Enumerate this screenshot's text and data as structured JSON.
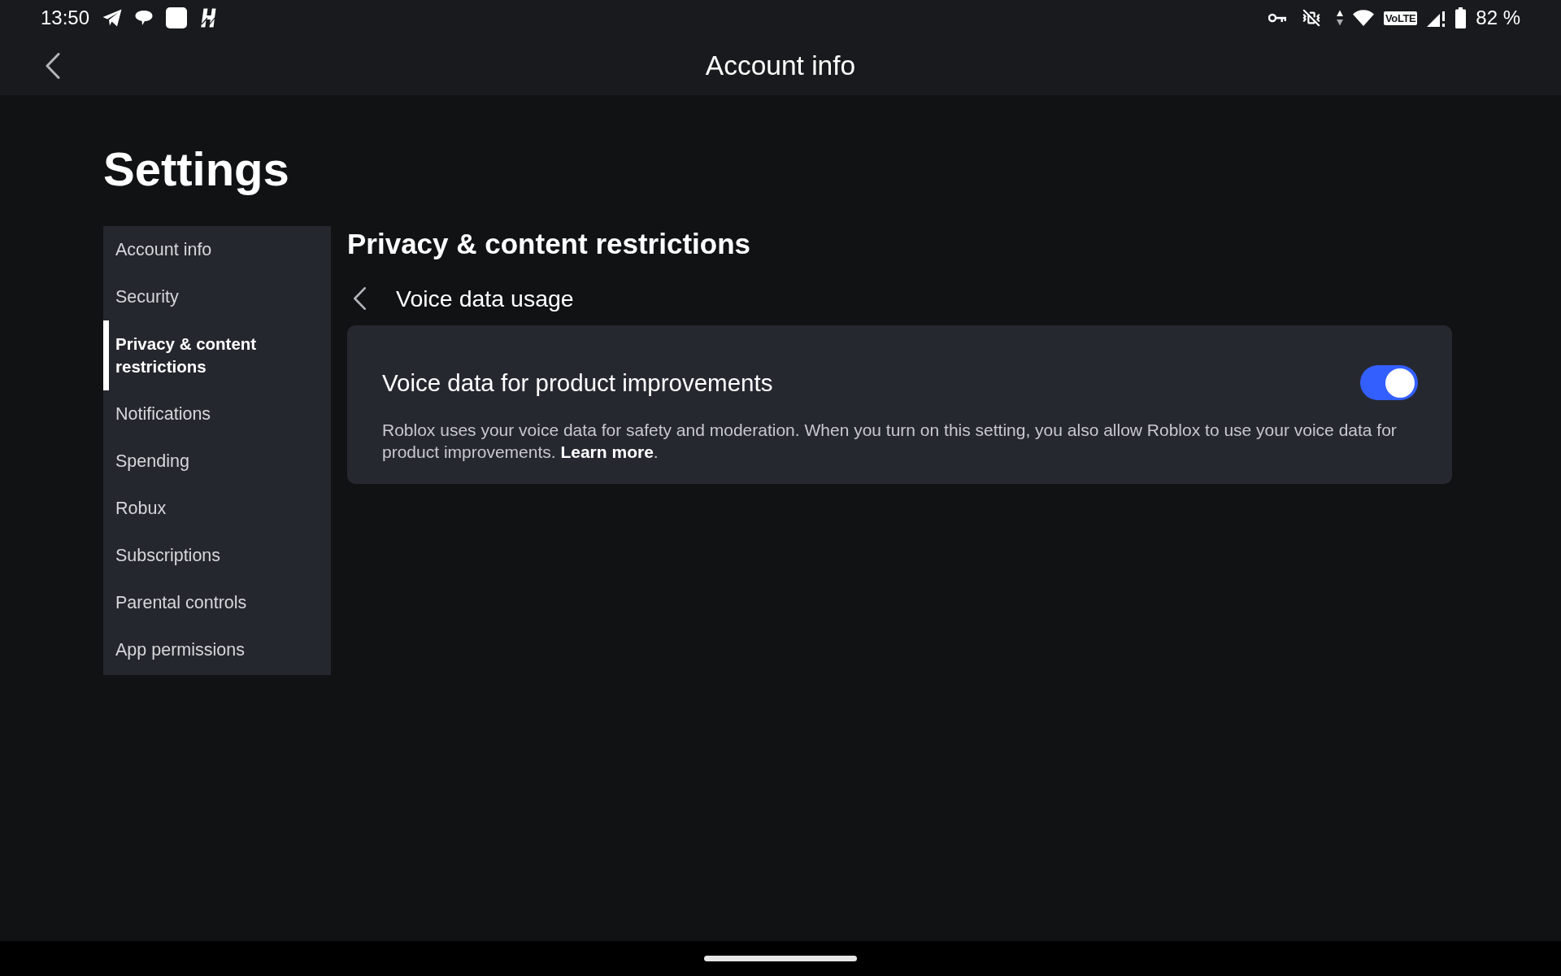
{
  "status_bar": {
    "time": "13:50",
    "network_type": "VoLTE",
    "battery": "82 %"
  },
  "header": {
    "title": "Account info"
  },
  "page_title": "Settings",
  "sidebar": {
    "items": [
      {
        "label": "Account info",
        "selected": false
      },
      {
        "label": "Security",
        "selected": false
      },
      {
        "label": "Privacy & content restrictions",
        "selected": true
      },
      {
        "label": "Notifications",
        "selected": false
      },
      {
        "label": "Spending",
        "selected": false
      },
      {
        "label": "Robux",
        "selected": false
      },
      {
        "label": "Subscriptions",
        "selected": false
      },
      {
        "label": "Parental controls",
        "selected": false
      },
      {
        "label": "App permissions",
        "selected": false
      }
    ]
  },
  "section": {
    "title": "Privacy & content restrictions",
    "subpage_title": "Voice data usage",
    "settings": [
      {
        "kind": "toggle",
        "title": "Voice data for product improvements",
        "on": true,
        "description": "Roblox uses your voice data for safety and moderation. When you turn on this setting, you also allow Roblox to use your voice data for product improvements.",
        "link": "Learn more",
        "after_link": "."
      }
    ]
  }
}
